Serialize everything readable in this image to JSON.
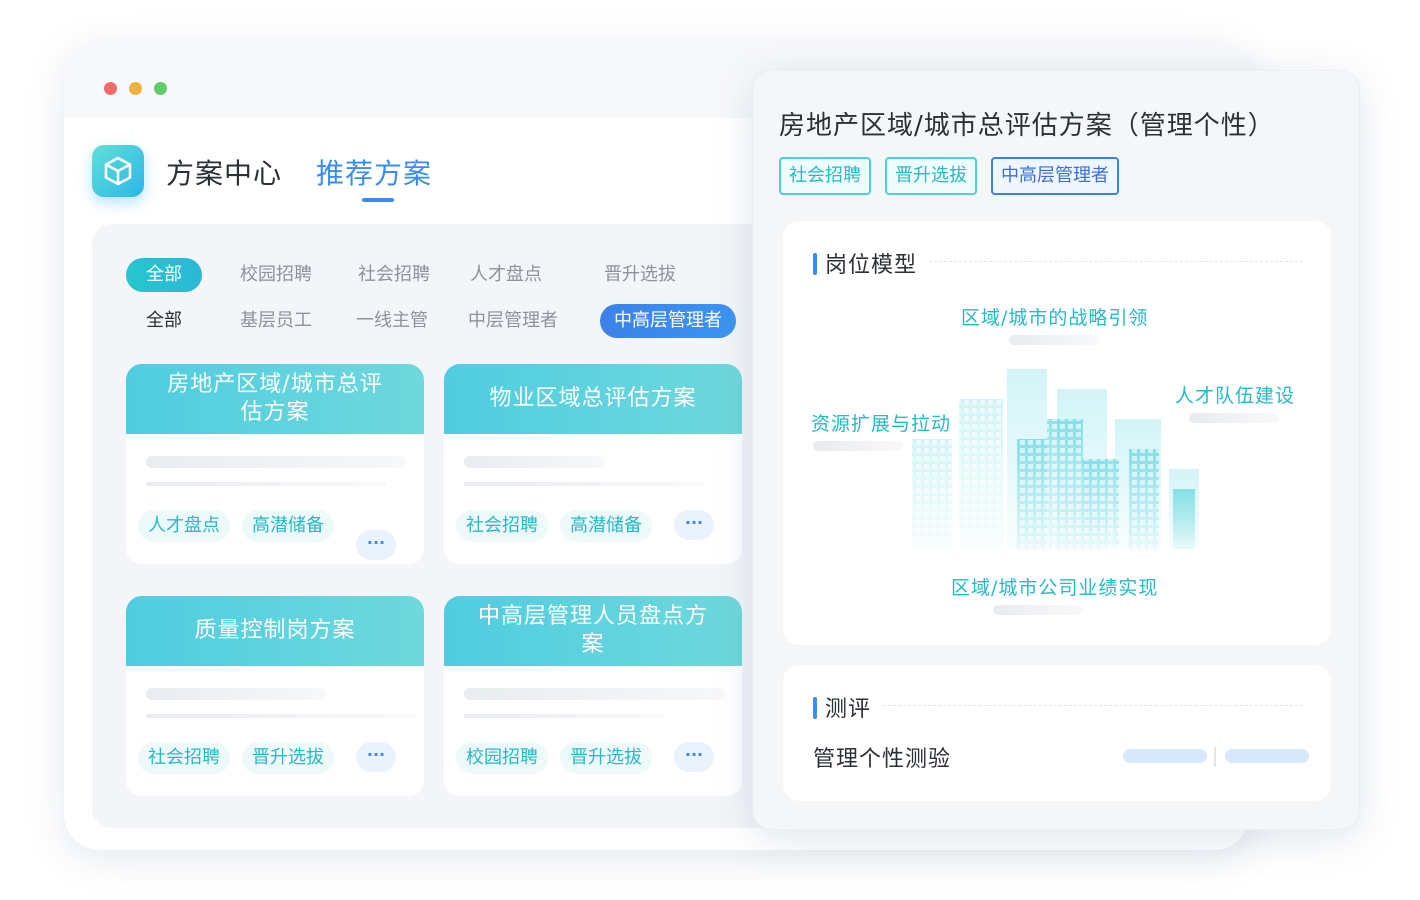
{
  "header": {
    "title": "方案中心",
    "active_tab": "推荐方案"
  },
  "filters": {
    "row1": [
      "全部",
      "校园招聘",
      "社会招聘",
      "人才盘点",
      "晋升选拔"
    ],
    "row2": [
      "全部",
      "基层员工",
      "一线主管",
      "中层管理者",
      "中高层管理者"
    ]
  },
  "cards": [
    {
      "title": "房地产区域/城市总评估方案",
      "tags": [
        "人才盘点",
        "高潜储备"
      ],
      "more": "···"
    },
    {
      "title": "物业区域总评估方案",
      "tags": [
        "社会招聘",
        "高潜储备"
      ],
      "more": "···"
    },
    {
      "title": "质量控制岗方案",
      "tags": [
        "社会招聘",
        "晋升选拔"
      ],
      "more": "···"
    },
    {
      "title": "中高层管理人员盘点方案",
      "tags": [
        "校园招聘",
        "晋升选拔"
      ],
      "more": "···"
    }
  ],
  "detail": {
    "title": "房地产区域/城市总评估方案（管理个性）",
    "tags": [
      "社会招聘",
      "晋升选拔",
      "中高层管理者"
    ],
    "model_section": {
      "title": "岗位模型",
      "labels": [
        "区域/城市的战略引领",
        "人才队伍建设",
        "资源扩展与拉动",
        "区域/城市公司业绩实现"
      ]
    },
    "eval_section": {
      "title": "测评",
      "item": "管理个性测验"
    }
  },
  "colors": {
    "accent_blue": "#3a8cf0",
    "accent_teal": "#26b9c6",
    "card_header": "#4fcde0"
  },
  "icons": {
    "app_logo": "cube-icon",
    "model_illustration": "city-buildings-illustration"
  }
}
